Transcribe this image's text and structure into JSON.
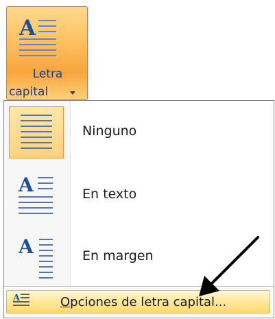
{
  "ribbon_button": {
    "label_line1": "Letra",
    "label_line2": "capital",
    "icon": "drop-cap-icon",
    "state": "pressed"
  },
  "menu": {
    "items": [
      {
        "label": "Ninguno",
        "icon": "drop-cap-none-icon",
        "selected": true
      },
      {
        "label": "En texto",
        "icon": "drop-cap-in-text-icon",
        "selected": false
      },
      {
        "label": "En margen",
        "icon": "drop-cap-in-margin-icon",
        "selected": false
      }
    ],
    "footer": {
      "label": "Opciones de letra capital...",
      "accelerator": "O",
      "icon": "drop-cap-options-icon"
    }
  },
  "annotation": {
    "icon": "pointer-arrow-icon"
  },
  "colors": {
    "ribbon_text": "#15428b",
    "pressed_gradient_mid": "#ffbf5d",
    "hover_border": "#dcb660",
    "selection_border": "#f29536"
  }
}
